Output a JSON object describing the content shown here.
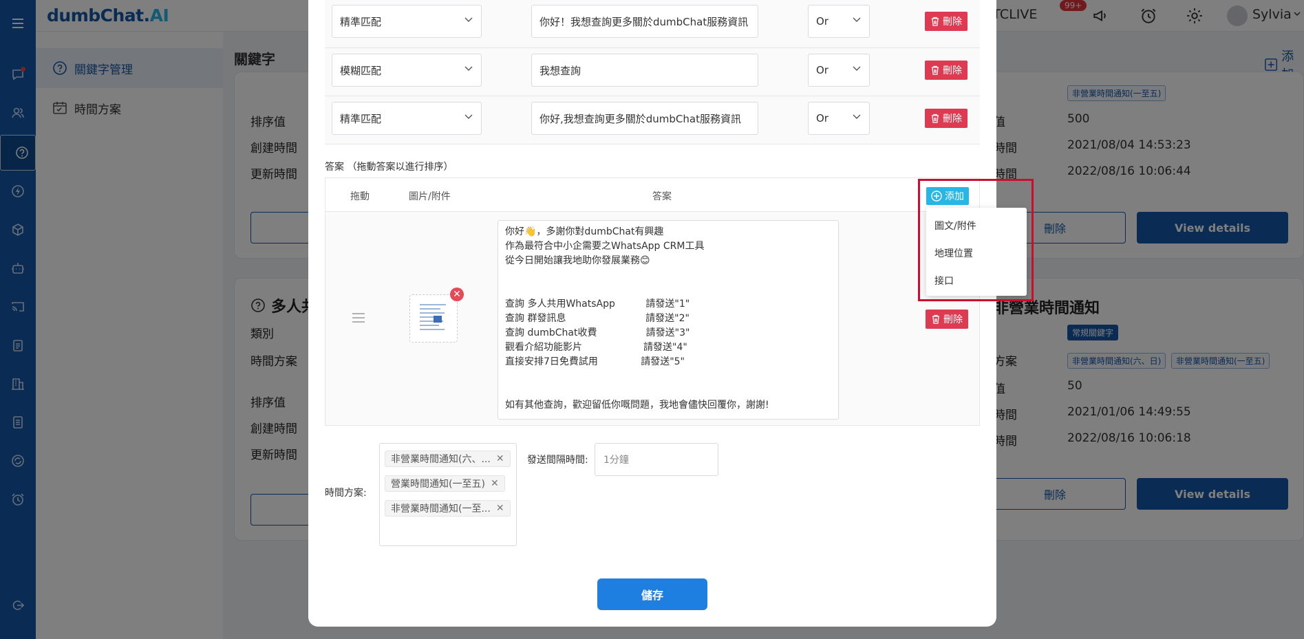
{
  "header": {
    "logo_main": "dumbChat.",
    "logo_ai": "AI",
    "account": "Chat TCLIVE",
    "notif_badge": "99+",
    "user_name": "Sylvia"
  },
  "submenu": {
    "items": [
      {
        "label": "關鍵字管理",
        "icon": "question-circle-icon"
      },
      {
        "label": "時間方案",
        "icon": "calendar-icon"
      }
    ]
  },
  "page": {
    "title": "關鍵字",
    "add_label": "添加"
  },
  "bg_cards": {
    "left_top": {
      "sort": "排序值",
      "created": "創建時間",
      "updated": "更新時間"
    },
    "right_top": {
      "tag": "非營業時間通知(一至五)",
      "sort_label": "值",
      "sort": "500",
      "created_label": "時間",
      "created": "2021/08/04 14:53:23",
      "updated_label": "時間",
      "updated": "2022/08/16 10:06:44",
      "delete": "刪除",
      "view": "View details"
    },
    "left_bottom": {
      "title": "多人共",
      "category": "類別",
      "plan": "時間方案",
      "sort": "排序值",
      "created": "創建時間",
      "updated": "更新時間"
    },
    "right_bottom": {
      "title": "非營業時間通知",
      "category_tag": "常規關鍵字",
      "plan_label": "方案",
      "plan_tags": [
        "非營業時間通知(六、日)",
        "非營業時間通知(一至五)"
      ],
      "sort_label": "值",
      "sort": "50",
      "created_label": "時間",
      "created": "2021/01/06 14:49:55",
      "updated_label": "時間",
      "updated": "2022/08/16 10:06:18",
      "delete": "刪除",
      "view": "View details"
    }
  },
  "modal": {
    "keyword_rows": [
      {
        "match": "精準匹配",
        "keyword": "你好！我想查詢更多關於dumbChat服務資訊",
        "logic": "Or",
        "delete": "刪除"
      },
      {
        "match": "模糊匹配",
        "keyword": "我想查詢",
        "logic": "Or",
        "delete": "刪除"
      },
      {
        "match": "精準匹配",
        "keyword": "你好,我想查詢更多關於dumbChat服務資訊",
        "logic": "Or",
        "delete": "刪除"
      }
    ],
    "answers_label": "答案 （拖動答案以進行排序）",
    "answers_head": {
      "drag": "拖動",
      "media": "圖片/附件",
      "answer": "答案",
      "add": "添加"
    },
    "answer_lines": [
      "你好👋，多謝你對dumbChat有興趣",
      "作為最符合中小企需要之WhatsApp CRM工具",
      "從今日開始讓我地助你發展業務😊",
      "",
      "",
      "查詢 多人共用WhatsApp          請發送\"1\"",
      "查詢 群發訊息                          請發送\"2\"",
      "查詢 dumbChat收費                請發送\"3\"",
      "觀看介紹功能影片                    請發送\"4\"",
      "直接安排7日免費試用              請發送\"5\"",
      "",
      "",
      "如有其他查詢，歡迎留低你嘅問題，我地會儘快回覆你，謝謝!"
    ],
    "answer_delete": "刪除",
    "add_menu": [
      "圖文/附件",
      "地理位置",
      "接口"
    ],
    "time_plan_label": "時間方案:",
    "time_plan_chips": [
      "非營業時間通知(六、...",
      "營業時間通知(一至五)",
      "非營業時間通知(一至..."
    ],
    "interval_label": "發送間隔時間:",
    "interval_placeholder": "1分鐘",
    "save": "儲存"
  }
}
